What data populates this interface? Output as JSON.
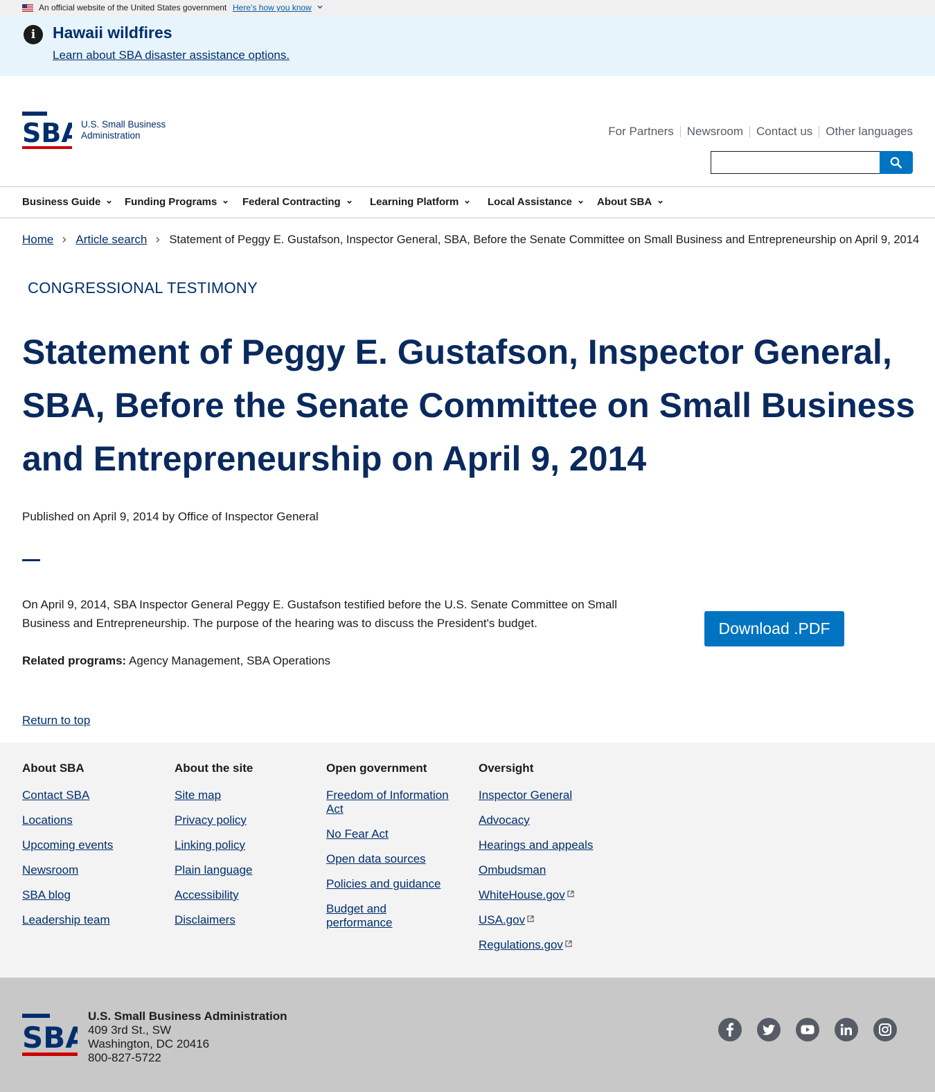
{
  "gov_banner": {
    "text": "An official website of the United States government",
    "how_link": "Here’s how you know"
  },
  "alert": {
    "title": "Hawaii wildfires",
    "link": "Learn about SBA disaster assistance options."
  },
  "header": {
    "logo_text_line1": "U.S. Small Business",
    "logo_text_line2": "Administration",
    "util_nav": [
      "For Partners",
      "Newsroom",
      "Contact us",
      "Other languages"
    ],
    "search_placeholder": ""
  },
  "main_nav": [
    "Business Guide",
    "Funding Programs",
    "Federal Contracting",
    "Learning Platform",
    "Local Assistance",
    "About SBA"
  ],
  "breadcrumb": {
    "home": "Home",
    "article_search": "Article search",
    "current": "Statement of Peggy E. Gustafson, Inspector General, SBA, Before the Senate Committee on Small Business and Entrepreneurship on April 9, 2014"
  },
  "article": {
    "eyebrow": "CONGRESSIONAL TESTIMONY",
    "title": "Statement of Peggy E. Gustafson, Inspector General, SBA, Before the Senate Committee on Small Business and Entrepreneurship on April 9, 2014",
    "published": "Published on April 9, 2014 by Office of Inspector General",
    "summary": "On April 9, 2014, SBA Inspector General Peggy E. Gustafson testified before the U.S. Senate Committee on Small Business and Entrepreneurship. The purpose of the hearing was to discuss the President's budget.",
    "related_label": "Related programs:",
    "related_value": " Agency Management, SBA Operations",
    "download_label": "Download .PDF",
    "return_top": "Return to top"
  },
  "footer": {
    "columns": [
      {
        "heading": "About SBA",
        "links": [
          "Contact SBA",
          "Locations",
          "Upcoming events",
          "Newsroom",
          "SBA blog",
          "Leadership team"
        ]
      },
      {
        "heading": "About the site",
        "links": [
          "Site map",
          "Privacy policy",
          "Linking policy",
          "Plain language",
          "Accessibility",
          "Disclaimers"
        ]
      },
      {
        "heading": "Open government",
        "links": [
          "Freedom of Information Act",
          "No Fear Act",
          "Open data sources",
          "Policies and guidance",
          "Budget and performance"
        ]
      },
      {
        "heading": "Oversight",
        "links": [
          "Inspector General",
          "Advocacy",
          "Hearings and appeals",
          "Ombudsman",
          "WhiteHouse.gov",
          "USA.gov",
          "Regulations.gov"
        ]
      }
    ],
    "org": "U.S. Small Business Administration",
    "address1": "409 3rd St., SW",
    "address2": "Washington, DC 20416",
    "phone": "800-827-5722",
    "social_icons": [
      "facebook-icon",
      "twitter-icon",
      "youtube-icon",
      "linkedin-icon",
      "instagram-icon"
    ]
  },
  "colors": {
    "brand_navy": "#002e6d",
    "brand_red": "#cc0000",
    "button_blue": "#0074c1",
    "alert_bg": "#e7f4fb",
    "footer_bg": "#f3f3f3",
    "footer_bottom_bg": "#c8c8c8"
  }
}
